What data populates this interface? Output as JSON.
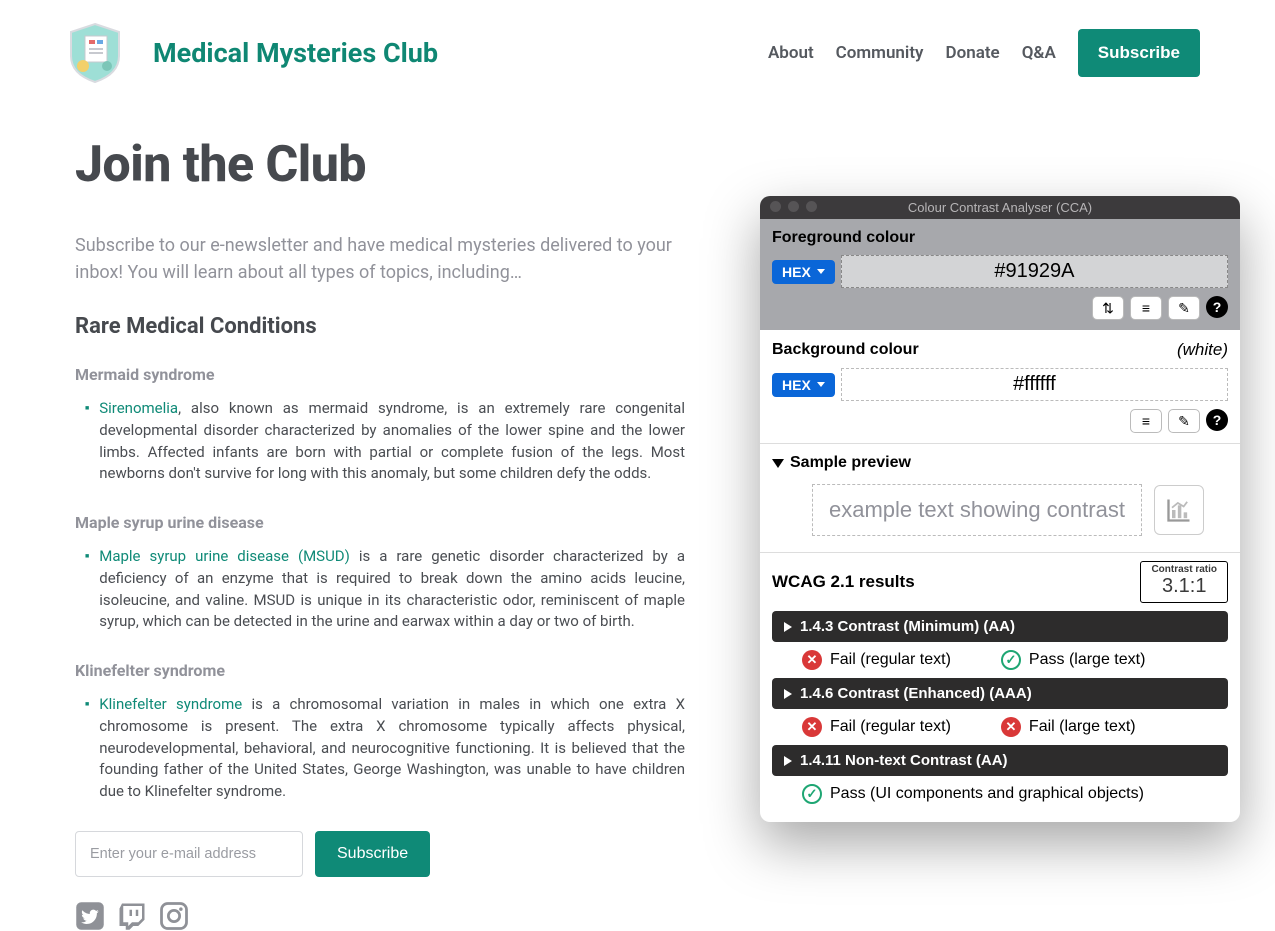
{
  "brand": {
    "title": "Medical Mysteries Club"
  },
  "nav": {
    "about": "About",
    "community": "Community",
    "donate": "Donate",
    "qa": "Q&A",
    "subscribe": "Subscribe"
  },
  "page": {
    "title": "Join the Club",
    "intro": "Subscribe to our e-newsletter and have medical mysteries delivered to your inbox! You will learn about all types of topics, including…",
    "section_heading": "Rare Medical Conditions"
  },
  "conditions": {
    "mermaid": {
      "heading": "Mermaid syndrome",
      "link": "Sirenomelia",
      "body": ", also known as mermaid syndrome, is an extremely rare congenital developmental disorder characterized by anomalies of the lower spine and the lower limbs. Affected infants are born with partial or complete fusion of the legs. Most newborns don't survive for long with this anomaly, but some children defy the odds."
    },
    "maple": {
      "heading": "Maple syrup urine disease",
      "link": "Maple syrup urine disease (MSUD)",
      "body": " is a rare genetic disorder characterized by a deficiency of an enzyme that is required to break down the amino acids leucine, isoleucine, and valine. MSUD is unique in its characteristic odor, reminiscent of maple syrup, which can be detected in the urine and earwax within a day or two of birth."
    },
    "kline": {
      "heading": "Klinefelter syndrome",
      "link": "Klinefelter syndrome",
      "body": " is a chromosomal variation in males in which one extra X chromosome is present. The extra X chromosome typically affects physical, neurodevelopmental, behavioral, and neurocognitive functioning. It is believed that the founding father of the United States, George Washington, was unable to have children due to Klinefelter syndrome."
    }
  },
  "form": {
    "placeholder": "Enter your e-mail address",
    "button": "Subscribe"
  },
  "cca": {
    "title": "Colour Contrast Analyser (CCA)",
    "fg_label": "Foreground colour",
    "fg_mode": "HEX",
    "fg_value": "#91929A",
    "bg_label": "Background colour",
    "bg_note": "(white)",
    "bg_mode": "HEX",
    "bg_value": "#ffffff",
    "preview_label": "Sample preview",
    "preview_text": "example text showing contrast",
    "results_title": "WCAG 2.1 results",
    "ratio_label": "Contrast ratio",
    "ratio_value": "3.1:1",
    "r143": "1.4.3 Contrast (Minimum) (AA)",
    "r143_fail": "Fail (regular text)",
    "r143_pass": "Pass (large text)",
    "r146": "1.4.6 Contrast (Enhanced) (AAA)",
    "r146_fail1": "Fail (regular text)",
    "r146_fail2": "Fail (large text)",
    "r1411": "1.4.11 Non-text Contrast (AA)",
    "r1411_pass": "Pass (UI components and graphical objects)"
  }
}
